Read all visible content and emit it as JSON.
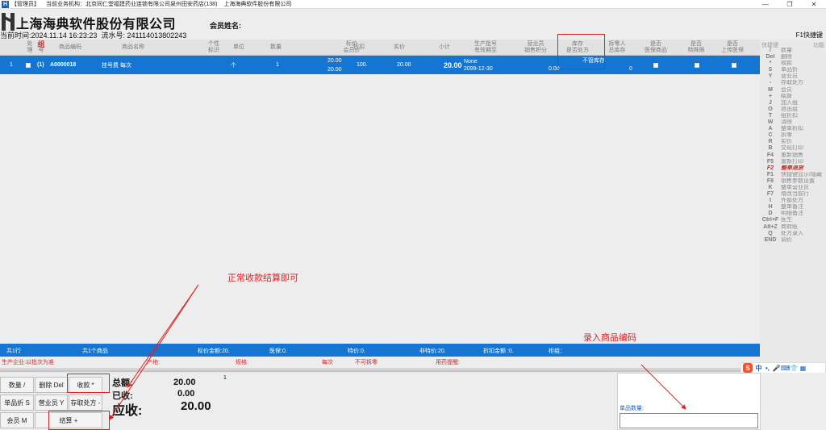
{
  "titlebar": {
    "role": "【管理员】",
    "org": "当前业务机构：北京同仁堂福建药业连锁有限公司泉州田安药店(138)",
    "company": "上海海典软件股份有限公司",
    "min": "—",
    "restore": "❐",
    "close": "✕"
  },
  "header": {
    "company": "上海海典软件股份有限公司",
    "member_label": "会员姓名:",
    "time_label": "当前时间:",
    "time": "2024.11.14 16:23:23",
    "serial_label": "流水号:",
    "serial": "241114013802243",
    "f1_label": "F1快捷键"
  },
  "table": {
    "headers": {
      "seq": "",
      "proc1": "处",
      "proc2": "理",
      "group1": "组",
      "group2": "号",
      "code": "商品编码",
      "name": "商品名称",
      "cert1": "个性",
      "cert2": "标识",
      "unit": "单位",
      "qty": "数量",
      "price1": "标价",
      "price2": "会员价",
      "disc": "折扣",
      "actual": "实价",
      "subtotal": "小计",
      "batch1": "生产批号",
      "batch2": "有效期至",
      "staff1": "营业员",
      "staff2": "销售积分",
      "stock1": "库存",
      "stock2": "是否处方",
      "disp1": "拆零人",
      "disp2": "总库存",
      "med1": "是否",
      "med2": "医保商品",
      "spec1": "是否",
      "spec2": "特殊限",
      "upl1": "是否",
      "upl2": "上传医保"
    },
    "row": {
      "seq": "1",
      "group": "(1)",
      "code": "A0000018",
      "name": "挂号费  每次",
      "unit": "个",
      "qty": "1",
      "price": "20.00",
      "member_price": "20.00",
      "disc": "100.",
      "actual": "20.00",
      "subtotal": "20.00",
      "batch": "None",
      "expiry": "2099-12-30",
      "points": "0.00",
      "stock_status": "不管库存",
      "total_stock": "0"
    }
  },
  "shortcuts": {
    "head_key": "快捷键",
    "head_func": "功能",
    "items": [
      {
        "k": "/",
        "l": "数量"
      },
      {
        "k": "Del",
        "l": "删除"
      },
      {
        "k": "*",
        "l": "收款"
      },
      {
        "k": "S",
        "l": "单品折"
      },
      {
        "k": "Y",
        "l": "营业员"
      },
      {
        "k": "-",
        "l": "存取处方"
      },
      {
        "k": "M",
        "l": "会员"
      },
      {
        "k": "+",
        "l": "结算"
      },
      {
        "k": "J",
        "l": "加入组"
      },
      {
        "k": "O",
        "l": "退出组"
      },
      {
        "k": "T",
        "l": "组折扣"
      },
      {
        "k": "W",
        "l": "清除"
      },
      {
        "k": "A",
        "l": "整单折扣"
      },
      {
        "k": "C",
        "l": "拆零"
      },
      {
        "k": "R",
        "l": "实价"
      },
      {
        "k": "B",
        "l": "交班打印"
      },
      {
        "k": "F4",
        "l": "重新销售"
      },
      {
        "k": "F5",
        "l": "重新打印"
      },
      {
        "k": "F2",
        "l": "整单退货",
        "hl": true
      },
      {
        "k": "F1",
        "l": "快捷键显示/隐藏"
      },
      {
        "k": "F8",
        "l": "销售参数设置"
      },
      {
        "k": "K",
        "l": "整单营业员"
      },
      {
        "k": "F7",
        "l": "增改当前行"
      },
      {
        "k": "I",
        "l": "外部处方"
      },
      {
        "k": "H",
        "l": "整单备注"
      },
      {
        "k": "D",
        "l": "明细备注"
      },
      {
        "k": "Ctrl+F",
        "l": "医生"
      },
      {
        "k": "Alt+Z",
        "l": "商转账"
      },
      {
        "k": "Q",
        "l": "处方录入"
      },
      {
        "k": "END",
        "l": "调价"
      }
    ]
  },
  "summary": {
    "rows": "共1行",
    "items": "共1个商品",
    "price_amount": "标价金额:20.",
    "insurance": "医保:0.",
    "special": "特价:0.",
    "non_special": "非特价:20.",
    "discount_amount": "折扣金额 :0.",
    "group": "柜组："
  },
  "info": {
    "producer": "生产企业:以批次为准",
    "origin": "产地:",
    "spec": "规格:",
    "per": "每次",
    "no_split": "不可拆零",
    "reminder": "用药提醒:"
  },
  "buttons": {
    "qty": "数量 /",
    "delete": "删除 Del",
    "collect": "收款 *",
    "single_disc": "单品折 S",
    "staff": "营业员 Y",
    "rx": "存取处方 -",
    "member": "会员 M",
    "settle": "结算 +"
  },
  "totals": {
    "total_label": "总额:",
    "total": "20.00",
    "paid_label": "已收:",
    "paid": "0.00",
    "due_label": "应收:",
    "due": "20.00",
    "count": "1"
  },
  "unit_qty_label": "单品数量:",
  "annotations": {
    "settle_note": "正常收款结算即可",
    "code_note": "录入商品编码"
  },
  "ime": {
    "logo": "S",
    "lang": "中",
    "punct": "•,",
    "mic": "🎤",
    "kb": "⌨",
    "skin": "👕",
    "grid": "▦"
  }
}
